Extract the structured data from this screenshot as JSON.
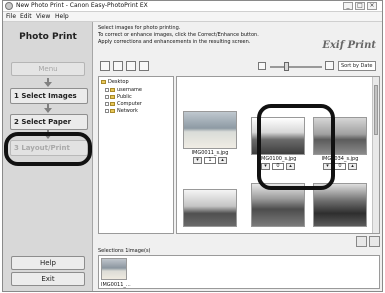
{
  "window": {
    "title": "New Photo Print - Canon Easy-PhotoPrint EX",
    "controls": {
      "minimize": "_",
      "maximize": "□",
      "close": "×"
    }
  },
  "menu": [
    "File",
    "Edit",
    "View",
    "Help"
  ],
  "left_panel": {
    "title": "Photo Print",
    "menu_button": "Menu",
    "steps": [
      {
        "label": "Select Images",
        "number": "1"
      },
      {
        "label": "Select Paper",
        "number": "2"
      },
      {
        "label": "Layout/Print",
        "number": "3"
      }
    ],
    "help_button": "Help",
    "exit_button": "Exit"
  },
  "main": {
    "instructions": [
      "Select images for photo printing.",
      "To correct or enhance images, click the Correct/Enhance button.",
      "Apply corrections and enhancements in the resulting screen."
    ],
    "brand": "Exif Print",
    "sort_label": "Sort by Date",
    "tree": [
      {
        "label": "Desktop"
      },
      {
        "label": "username"
      },
      {
        "label": "Public"
      },
      {
        "label": "Computer"
      },
      {
        "label": "Network"
      }
    ],
    "thumbnails": [
      {
        "name": "IMG0011_s.jpg",
        "qty": "1"
      },
      {
        "name": "IMG0100_s.jpg",
        "qty": "0"
      },
      {
        "name": "IMG0034_s.jpg",
        "qty": "0"
      },
      {
        "name": "",
        "qty": ""
      },
      {
        "name": "",
        "qty": ""
      },
      {
        "name": "",
        "qty": ""
      }
    ],
    "selections_label": "Selections 1image(s)",
    "selection_name": "IMG0011_..."
  },
  "icons": {
    "app": "app-icon",
    "tb": [
      "view-list-icon",
      "view-grid-icon",
      "correct-enhance-icon",
      "photo-tool-icon"
    ],
    "zoom_out": "zoom-out-icon",
    "zoom_in": "zoom-in-icon",
    "sel_tools": [
      "deselect-icon",
      "select-all-icon"
    ]
  },
  "colors": {
    "highlight_ring": "#111111",
    "selected_tree": "#3a6fc2"
  }
}
